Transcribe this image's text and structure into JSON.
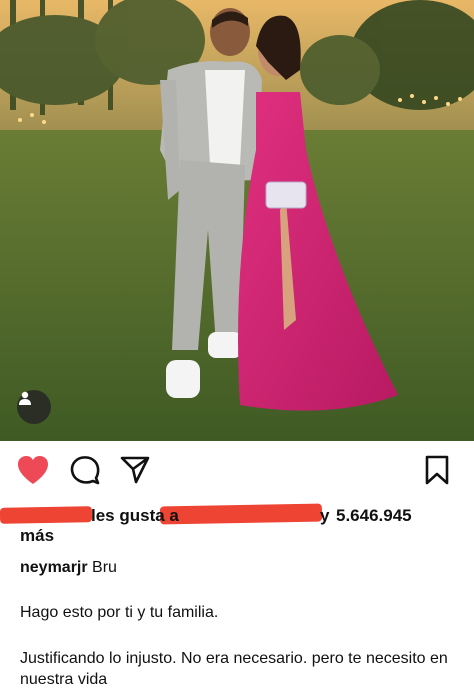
{
  "post": {
    "likes_prefix": "les gusta a",
    "likes_connector": "y",
    "likes_count": "5.646.945",
    "likes_suffix": "más",
    "username": "neymarjr",
    "caption_first": "Bru",
    "comment_line1": "Hago esto por ti y tu familia.",
    "comment_line2": "Justificando lo injusto. No era necesario. pero te necesito en nuestra vida"
  },
  "icons": {
    "like": "heart-icon",
    "comment": "comment-icon",
    "share": "send-icon",
    "save": "bookmark-icon",
    "tags": "user-tag-icon"
  },
  "colors": {
    "like_active": "#ed4956",
    "redaction": "#ee4433",
    "text": "#111111"
  }
}
